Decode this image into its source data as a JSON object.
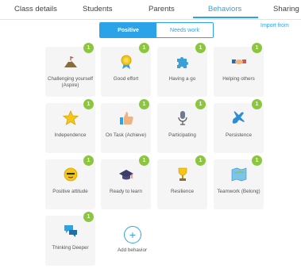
{
  "tabs": [
    {
      "label": "Class details"
    },
    {
      "label": "Students"
    },
    {
      "label": "Parents"
    },
    {
      "label": "Behaviors",
      "active": true
    },
    {
      "label": "Sharing"
    }
  ],
  "toggle": {
    "positive": "Positive",
    "needs_work": "Needs work",
    "selected": "Positive"
  },
  "import_link": "Import from",
  "skills": [
    {
      "label": "Challenging yourself (Aspire)",
      "points": "1",
      "icon": "mountain-flag-icon"
    },
    {
      "label": "Good effort",
      "points": "1",
      "icon": "medal-icon"
    },
    {
      "label": "Having a go",
      "points": "1",
      "icon": "puzzle-icon"
    },
    {
      "label": "Helping others",
      "points": "1",
      "icon": "handshake-icon"
    },
    {
      "label": "Independence",
      "points": "1",
      "icon": "star-icon"
    },
    {
      "label": "On Task (Achieve)",
      "points": "1",
      "icon": "thumbs-up-icon"
    },
    {
      "label": "Participating",
      "points": "1",
      "icon": "microphone-icon"
    },
    {
      "label": "Persistence",
      "points": "1",
      "icon": "airplane-icon"
    },
    {
      "label": "Positive attitude",
      "points": "1",
      "icon": "smiley-icon"
    },
    {
      "label": "Ready to learn",
      "points": "1",
      "icon": "graduation-cap-icon"
    },
    {
      "label": "Resilience",
      "points": "1",
      "icon": "trophy-icon"
    },
    {
      "label": "Teamwork (Belong)",
      "points": "1",
      "icon": "map-icon"
    },
    {
      "label": "Thinking Deeper",
      "points": "1",
      "icon": "speech-bubbles-icon"
    }
  ],
  "add_behavior": {
    "label": "Add behavior",
    "symbol": "+"
  },
  "colors": {
    "accent": "#2ba3e8",
    "badge": "#8cc63f",
    "card_bg": "#f5f5f5"
  }
}
